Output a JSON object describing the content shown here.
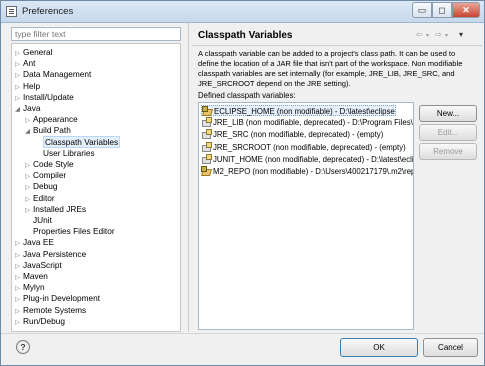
{
  "window": {
    "title": "Preferences",
    "minimize_glyph": "▭",
    "maximize_glyph": "◻",
    "close_glyph": "✕"
  },
  "filter": {
    "placeholder": "type filter text"
  },
  "tree": {
    "items": [
      {
        "label": "General",
        "arrow": "▷"
      },
      {
        "label": "Ant",
        "arrow": "▷"
      },
      {
        "label": "Data Management",
        "arrow": "▷"
      },
      {
        "label": "Help",
        "arrow": "▷"
      },
      {
        "label": "Install/Update",
        "arrow": "▷"
      },
      {
        "label": "Java",
        "arrow": "◢"
      },
      {
        "label": "Appearance",
        "arrow": "▷"
      },
      {
        "label": "Build Path",
        "arrow": "◢"
      },
      {
        "label": "Classpath Variables",
        "arrow": ""
      },
      {
        "label": "User Libraries",
        "arrow": ""
      },
      {
        "label": "Code Style",
        "arrow": "▷"
      },
      {
        "label": "Compiler",
        "arrow": "▷"
      },
      {
        "label": "Debug",
        "arrow": "▷"
      },
      {
        "label": "Editor",
        "arrow": "▷"
      },
      {
        "label": "Installed JREs",
        "arrow": "▷"
      },
      {
        "label": "JUnit",
        "arrow": ""
      },
      {
        "label": "Properties Files Editor",
        "arrow": ""
      },
      {
        "label": "Java EE",
        "arrow": "▷"
      },
      {
        "label": "Java Persistence",
        "arrow": "▷"
      },
      {
        "label": "JavaScript",
        "arrow": "▷"
      },
      {
        "label": "Maven",
        "arrow": "▷"
      },
      {
        "label": "Mylyn",
        "arrow": "▷"
      },
      {
        "label": "Plug-in Development",
        "arrow": "▷"
      },
      {
        "label": "Remote Systems",
        "arrow": "▷"
      },
      {
        "label": "Run/Debug",
        "arrow": "▷"
      }
    ],
    "selected_label": "Classpath Variables"
  },
  "page": {
    "title": "Classpath Variables",
    "description": "A classpath variable can be added to a project's class path. It can be used to define the location of a JAR file that isn't part of the workspace. Non modifiable classpath variables are set internally (for example, JRE_LIB, JRE_SRC, and JRE_SRCROOT depend on the JRE setting).",
    "defined_label": "Defined classpath variables:",
    "nav": {
      "back": "⇦",
      "dropdown": "▾",
      "forward": "⇨",
      "menu": "▾"
    }
  },
  "variables": [
    {
      "text": "ECLIPSE_HOME (non modifiable) - D:\\latest\\eclipse",
      "icon": "locked-variable-icon"
    },
    {
      "text": "JRE_LIB (non modifiable, deprecated) - D:\\Program Files\\Jav",
      "icon": "deprecated-variable-icon"
    },
    {
      "text": "JRE_SRC (non modifiable, deprecated) - (empty)",
      "icon": "deprecated-variable-icon"
    },
    {
      "text": "JRE_SRCROOT (non modifiable, deprecated) - (empty)",
      "icon": "deprecated-variable-icon"
    },
    {
      "text": "JUNIT_HOME (non modifiable, deprecated) - D:\\latest\\eclip",
      "icon": "deprecated-variable-icon"
    },
    {
      "text": "M2_REPO (non modifiable) - D:\\Users\\400217179\\.m2\\repo",
      "icon": "locked-variable-icon"
    }
  ],
  "buttons": {
    "new": "New...",
    "edit": "Edit...",
    "remove": "Remove",
    "ok": "OK",
    "cancel": "Cancel",
    "help": "?"
  }
}
